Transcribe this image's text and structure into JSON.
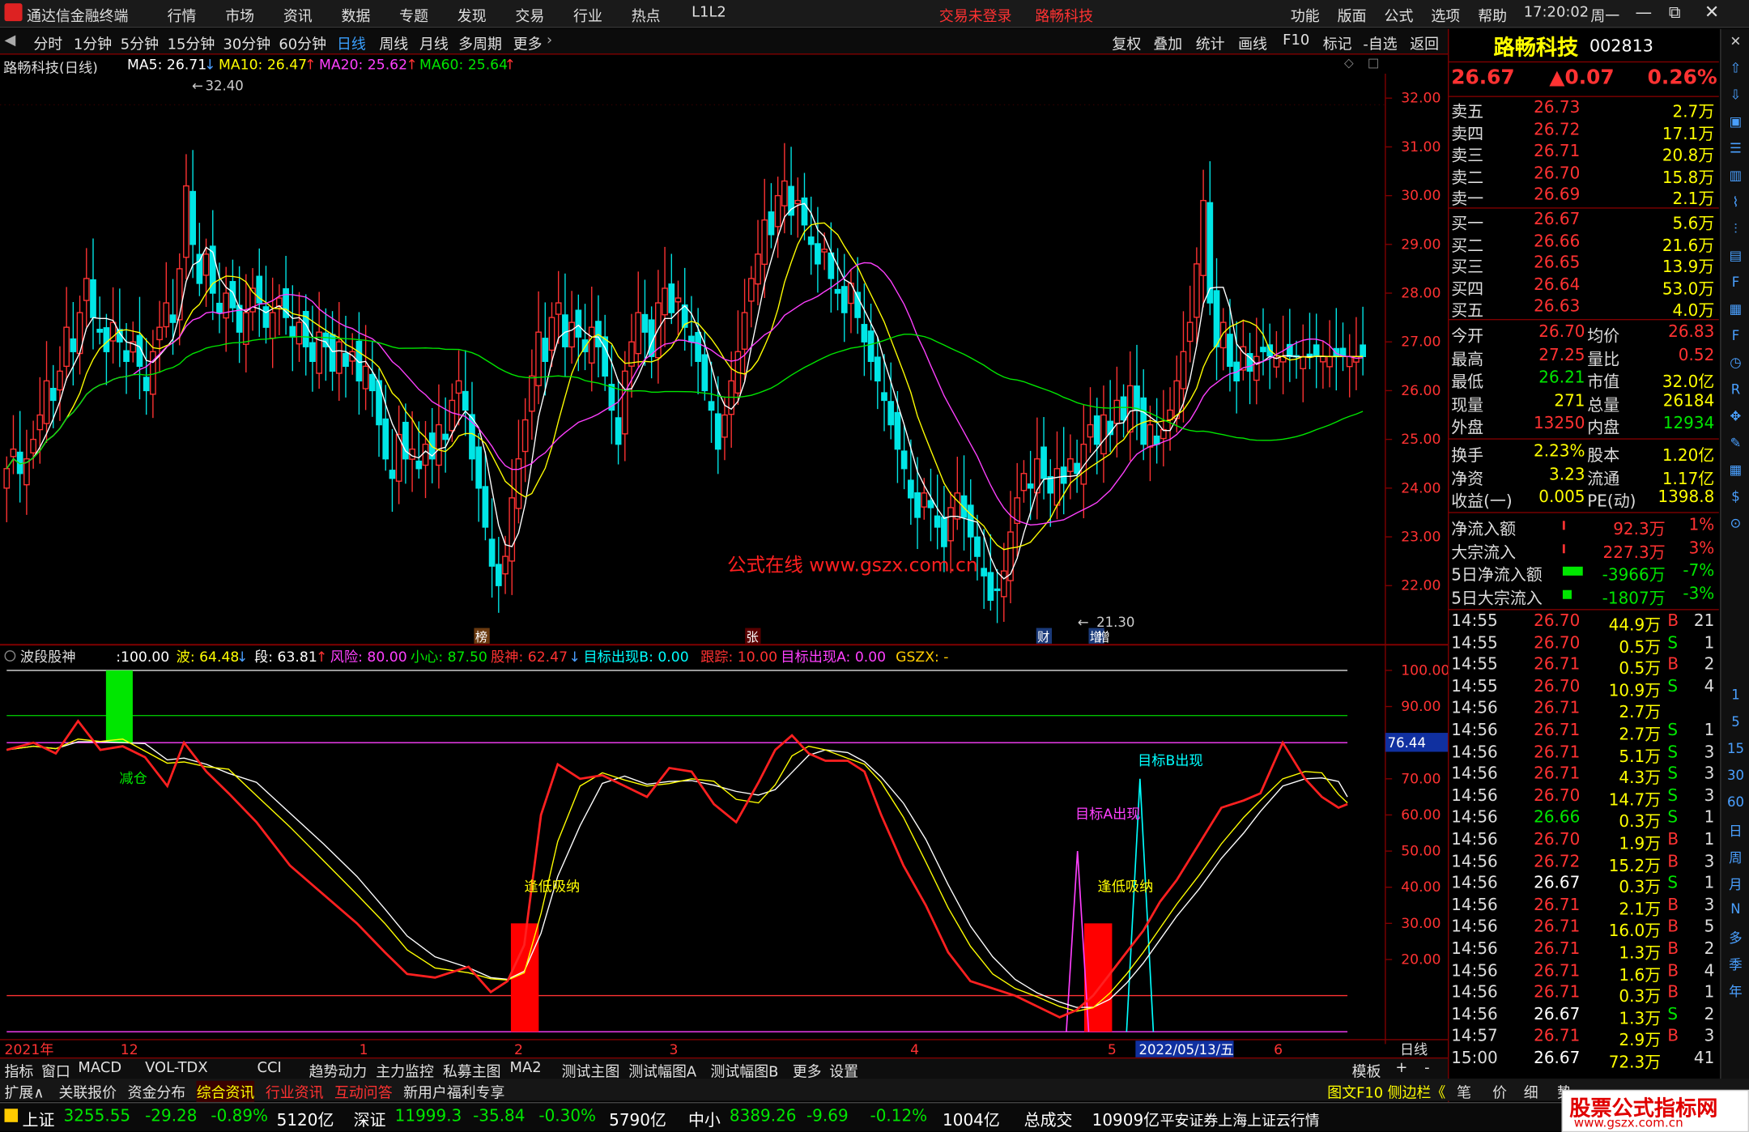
{
  "titlebar": {
    "app_name": "通达信金融终端",
    "menu": [
      "行情",
      "市场",
      "资讯",
      "数据",
      "专题",
      "发现",
      "交易",
      "行业",
      "热点",
      "L1L2"
    ],
    "trade_status": "交易未登录",
    "stock_name": "路畅科技",
    "right_menu": [
      "功能",
      "版面",
      "公式",
      "选项",
      "帮助"
    ],
    "time": "17:20:02",
    "weekday": "周一"
  },
  "toolbar": {
    "periods": [
      "分时",
      "1分钟",
      "5分钟",
      "15分钟",
      "30分钟",
      "60分钟",
      "日线",
      "周线",
      "月线",
      "多周期",
      "更多"
    ],
    "active": "日线",
    "right": [
      "复权",
      "叠加",
      "统计",
      "画线",
      "F10",
      "标记",
      "-自选",
      "返回"
    ]
  },
  "ma": {
    "title": "路畅科技(日线)",
    "ma5": "MA5: 26.71",
    "ma10": "MA10: 26.47",
    "ma20": "MA20: 25.62",
    "ma60": "MA60: 25.64"
  },
  "price_axis": [
    "32.00",
    "31.00",
    "30.00",
    "29.00",
    "28.00",
    "27.00",
    "26.00",
    "25.00",
    "24.00",
    "23.00",
    "22.00"
  ],
  "annotations": {
    "high": "32.40",
    "low": "21.30",
    "watermark": "公式在线  www.gszx.com.cn",
    "markers": [
      "榜",
      "张",
      "财",
      "增"
    ]
  },
  "indicator": {
    "name": "波段股神",
    "v1": ":100.00",
    "wave": "波: 64.48",
    "seg": "段: 63.81",
    "risk": "风险: 80.00",
    "careful": "小心: 87.50",
    "god": "股神: 62.47",
    "targetB": "目标出现B: 0.00",
    "track": "跟踪: 10.00",
    "targetA": "目标出现A: 0.00",
    "gszx": "GSZX: -",
    "axis": [
      "100.00",
      "90.00",
      "80.00",
      "70.00",
      "60.00",
      "50.00",
      "40.00",
      "30.00",
      "20.00"
    ],
    "cursor_value": "76.44",
    "labels": {
      "reduce": "减仓",
      "buy1": "逢低吸纳",
      "buy2": "逢低吸纳",
      "targetA": "目标A出现",
      "targetB": "目标B出现"
    }
  },
  "date_axis": {
    "labels": [
      "2021年",
      "12",
      "1",
      "2",
      "3",
      "4",
      "5",
      "6"
    ],
    "cursor_date": "2022/05/13/五",
    "period": "日线"
  },
  "panel": {
    "name": "路畅科技",
    "code": "002813",
    "price": "26.67",
    "change": "▲0.07",
    "pct": "0.26%",
    "asks": [
      {
        "label": "卖五",
        "price": "26.73",
        "vol": "2.7万"
      },
      {
        "label": "卖四",
        "price": "26.72",
        "vol": "17.1万"
      },
      {
        "label": "卖三",
        "price": "26.71",
        "vol": "20.8万"
      },
      {
        "label": "卖二",
        "price": "26.70",
        "vol": "15.8万"
      },
      {
        "label": "卖一",
        "price": "26.69",
        "vol": "2.1万"
      }
    ],
    "bids": [
      {
        "label": "买一",
        "price": "26.67",
        "vol": "5.6万"
      },
      {
        "label": "买二",
        "price": "26.66",
        "vol": "21.6万"
      },
      {
        "label": "买三",
        "price": "26.65",
        "vol": "13.9万"
      },
      {
        "label": "买四",
        "price": "26.64",
        "vol": "53.0万"
      },
      {
        "label": "买五",
        "price": "26.63",
        "vol": "4.0万"
      }
    ],
    "stats": [
      [
        "今开",
        "26.70",
        "均价",
        "26.83"
      ],
      [
        "最高",
        "27.25",
        "量比",
        "0.52"
      ],
      [
        "最低",
        "26.21",
        "市值",
        "32.0亿"
      ],
      [
        "现量",
        "271",
        "总量",
        "26184"
      ],
      [
        "外盘",
        "13250",
        "内盘",
        "12934"
      ]
    ],
    "stats2": [
      [
        "换手",
        "2.23%",
        "股本",
        "1.20亿"
      ],
      [
        "净资",
        "3.23",
        "流通",
        "1.17亿"
      ],
      [
        "收益(一)",
        "0.005",
        "PE(动)",
        "1398.8"
      ]
    ],
    "flows": [
      [
        "净流入额",
        "92.3万",
        "1%"
      ],
      [
        "大宗流入",
        "227.3万",
        "3%"
      ],
      [
        "5日净流入额",
        "-3966万",
        "-7%"
      ],
      [
        "5日大宗流入",
        "-1807万",
        "-3%"
      ]
    ],
    "ticks": [
      [
        "14:55",
        "26.70",
        "44.9万",
        "B",
        "21"
      ],
      [
        "14:55",
        "26.70",
        "0.5万",
        "S",
        "1"
      ],
      [
        "14:55",
        "26.71",
        "0.5万",
        "B",
        "2"
      ],
      [
        "14:55",
        "26.70",
        "10.9万",
        "S",
        "4"
      ],
      [
        "14:56",
        "26.71",
        "2.7万",
        "",
        ""
      ],
      [
        "14:56",
        "26.71",
        "2.7万",
        "S",
        "1"
      ],
      [
        "14:56",
        "26.71",
        "5.1万",
        "S",
        "3"
      ],
      [
        "14:56",
        "26.71",
        "4.3万",
        "S",
        "3"
      ],
      [
        "14:56",
        "26.70",
        "14.7万",
        "S",
        "3"
      ],
      [
        "14:56",
        "26.66",
        "0.3万",
        "S",
        "1"
      ],
      [
        "14:56",
        "26.70",
        "1.9万",
        "B",
        "1"
      ],
      [
        "14:56",
        "26.72",
        "15.2万",
        "B",
        "3"
      ],
      [
        "14:56",
        "26.67",
        "0.3万",
        "S",
        "1"
      ],
      [
        "14:56",
        "26.71",
        "2.1万",
        "B",
        "3"
      ],
      [
        "14:56",
        "26.71",
        "16.0万",
        "B",
        "5"
      ],
      [
        "14:56",
        "26.71",
        "1.3万",
        "B",
        "2"
      ],
      [
        "14:56",
        "26.71",
        "1.6万",
        "B",
        "4"
      ],
      [
        "14:56",
        "26.71",
        "0.3万",
        "B",
        "1"
      ],
      [
        "14:56",
        "26.67",
        "1.3万",
        "S",
        "2"
      ],
      [
        "14:57",
        "26.71",
        "2.9万",
        "B",
        "3"
      ],
      [
        "15:00",
        "26.67",
        "72.3万",
        "",
        "41"
      ]
    ]
  },
  "bottom_tabs": [
    "指标",
    "窗口",
    "MACD",
    "VOL-TDX",
    "CCI",
    "趋势动力",
    "主力监控",
    "私募主图",
    "MA2",
    "测试主图",
    "测试幅图A",
    "测试幅图B",
    "更多",
    "设置"
  ],
  "bottom_right": [
    "模板",
    "+",
    "-"
  ],
  "tabs2": [
    "扩展∧",
    "关联报价",
    "资金分布",
    "综合资讯",
    "行业资讯",
    "互动问答",
    "新用户福利专享"
  ],
  "tabs2_right": [
    "图文F10",
    "侧边栏《",
    "笔",
    "价",
    "细",
    "势"
  ],
  "status": {
    "sh_label": "上证",
    "sh": "3255.55",
    "sh_chg": "-29.28",
    "sh_pct": "-0.89%",
    "sh_amt": "5120亿",
    "sz_label": "深证",
    "sz": "11999.3",
    "sz_chg": "-35.84",
    "sz_pct": "-0.30%",
    "sz_amt": "5790亿",
    "zx_label": "中小",
    "zx": "8389.26",
    "zx_chg": "-9.69",
    "zx_pct": "-0.12%",
    "zx_amt": "1004亿",
    "total_label": "总成交",
    "total": "10909亿",
    "broker": "平安证券上海上证云行情",
    "logo": "股票公式指标网",
    "logo_url": "www.gszx.com.cn"
  },
  "sidebar_icons": [
    "close-icon",
    "up-arrow-icon",
    "down-arrow-icon",
    "chart-icon",
    "news-icon",
    "bar-icon",
    "line-icon",
    "candle-icon",
    "list-icon",
    "f10-icon",
    "calendar-icon",
    "f-icon",
    "clock-icon",
    "rsi-icon",
    "move-icon",
    "pencil-icon",
    "grid-icon",
    "dollar-icon",
    "pin-icon"
  ],
  "sidebar_periods": [
    "1",
    "5",
    "15",
    "30",
    "60",
    "日",
    "周",
    "月",
    "N",
    "多",
    "季",
    "年"
  ]
}
